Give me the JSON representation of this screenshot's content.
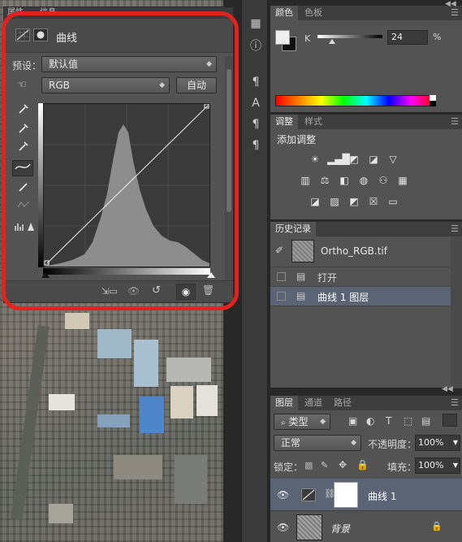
{
  "properties": {
    "tabs": [
      "属性",
      "信息"
    ],
    "title": "曲线",
    "preset_label": "预设：",
    "preset_value": "默认值",
    "channel_value": "RGB",
    "auto_label": "自动"
  },
  "color_panel": {
    "tabs": [
      "颜色",
      "色板"
    ],
    "channel_letter": "K",
    "value": "24",
    "unit": "%"
  },
  "adjustments_panel": {
    "tabs": [
      "调整",
      "样式"
    ],
    "title": "添加调整"
  },
  "history_panel": {
    "tab": "历史记录",
    "snapshot_name": "Ortho_RGB.tif",
    "items": [
      "打开",
      "曲线 1 图层"
    ]
  },
  "layers_panel": {
    "tabs": [
      "图层",
      "通道",
      "路径"
    ],
    "filter_label": "类型",
    "blend_mode": "正常",
    "opacity_label": "不透明度：",
    "opacity_value": "100%",
    "lock_label": "锁定：",
    "fill_label": "填充：",
    "fill_value": "100%",
    "layers": [
      {
        "name": "曲线 1"
      },
      {
        "name": "背景"
      }
    ]
  },
  "colors": {
    "accent_red": "#e3211f",
    "panel": "#535353",
    "selection": "#5a6475"
  }
}
